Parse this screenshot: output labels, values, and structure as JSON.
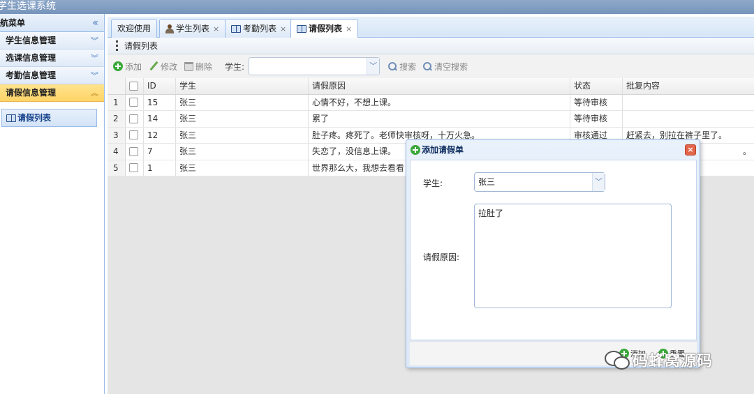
{
  "app": {
    "title": "学生选课系统"
  },
  "sidebar": {
    "header": "航菜单",
    "collapse_glyph": "«",
    "sections": [
      {
        "label": "学生信息管理",
        "active": false
      },
      {
        "label": "选课信息管理",
        "active": false
      },
      {
        "label": "考勤信息管理",
        "active": false
      },
      {
        "label": "请假信息管理",
        "active": true
      }
    ],
    "items": [
      {
        "label": "请假列表",
        "icon": "book-icon"
      }
    ]
  },
  "tabs": [
    {
      "label": "欢迎使用",
      "closable": false,
      "active": false
    },
    {
      "label": "学生列表",
      "closable": true,
      "active": false,
      "icon": "user-icon"
    },
    {
      "label": "考勤列表",
      "closable": true,
      "active": false,
      "icon": "book-icon"
    },
    {
      "label": "请假列表",
      "closable": true,
      "active": true,
      "icon": "book-icon"
    }
  ],
  "panel": {
    "title": "请假列表"
  },
  "toolbar": {
    "add": "添加",
    "edit": "修改",
    "delete": "删除",
    "student_label": "学生:",
    "search": "搜索",
    "clear_search": "清空搜索"
  },
  "table": {
    "columns": [
      "ID",
      "学生",
      "请假原因",
      "状态",
      "批复内容"
    ],
    "rows": [
      {
        "n": "1",
        "id": "15",
        "student": "张三",
        "reason": "心情不好，不想上课。",
        "status": "等待审核",
        "reply": ""
      },
      {
        "n": "2",
        "id": "14",
        "student": "张三",
        "reason": "累了",
        "status": "等待审核",
        "reply": ""
      },
      {
        "n": "3",
        "id": "12",
        "student": "张三",
        "reason": "肚子疼。疼死了。老师快审核呀，十万火急。",
        "status": "审核通过",
        "reply": "赶紧去，别拉在裤子里了。"
      },
      {
        "n": "4",
        "id": "7",
        "student": "张三",
        "reason": "失恋了，没信息上课。",
        "status": "",
        "reply": "。"
      },
      {
        "n": "5",
        "id": "1",
        "student": "张三",
        "reason": "世界那么大，我想去看看！",
        "status": "",
        "reply": ""
      }
    ]
  },
  "dialog": {
    "title": "添加请假单",
    "student_label": "学生:",
    "student_value": "张三",
    "reason_label": "请假原因:",
    "reason_value": "拉肚了",
    "add_button": "添加",
    "reset_button": "重置"
  },
  "watermark": {
    "text": "码蜂窝源码"
  }
}
